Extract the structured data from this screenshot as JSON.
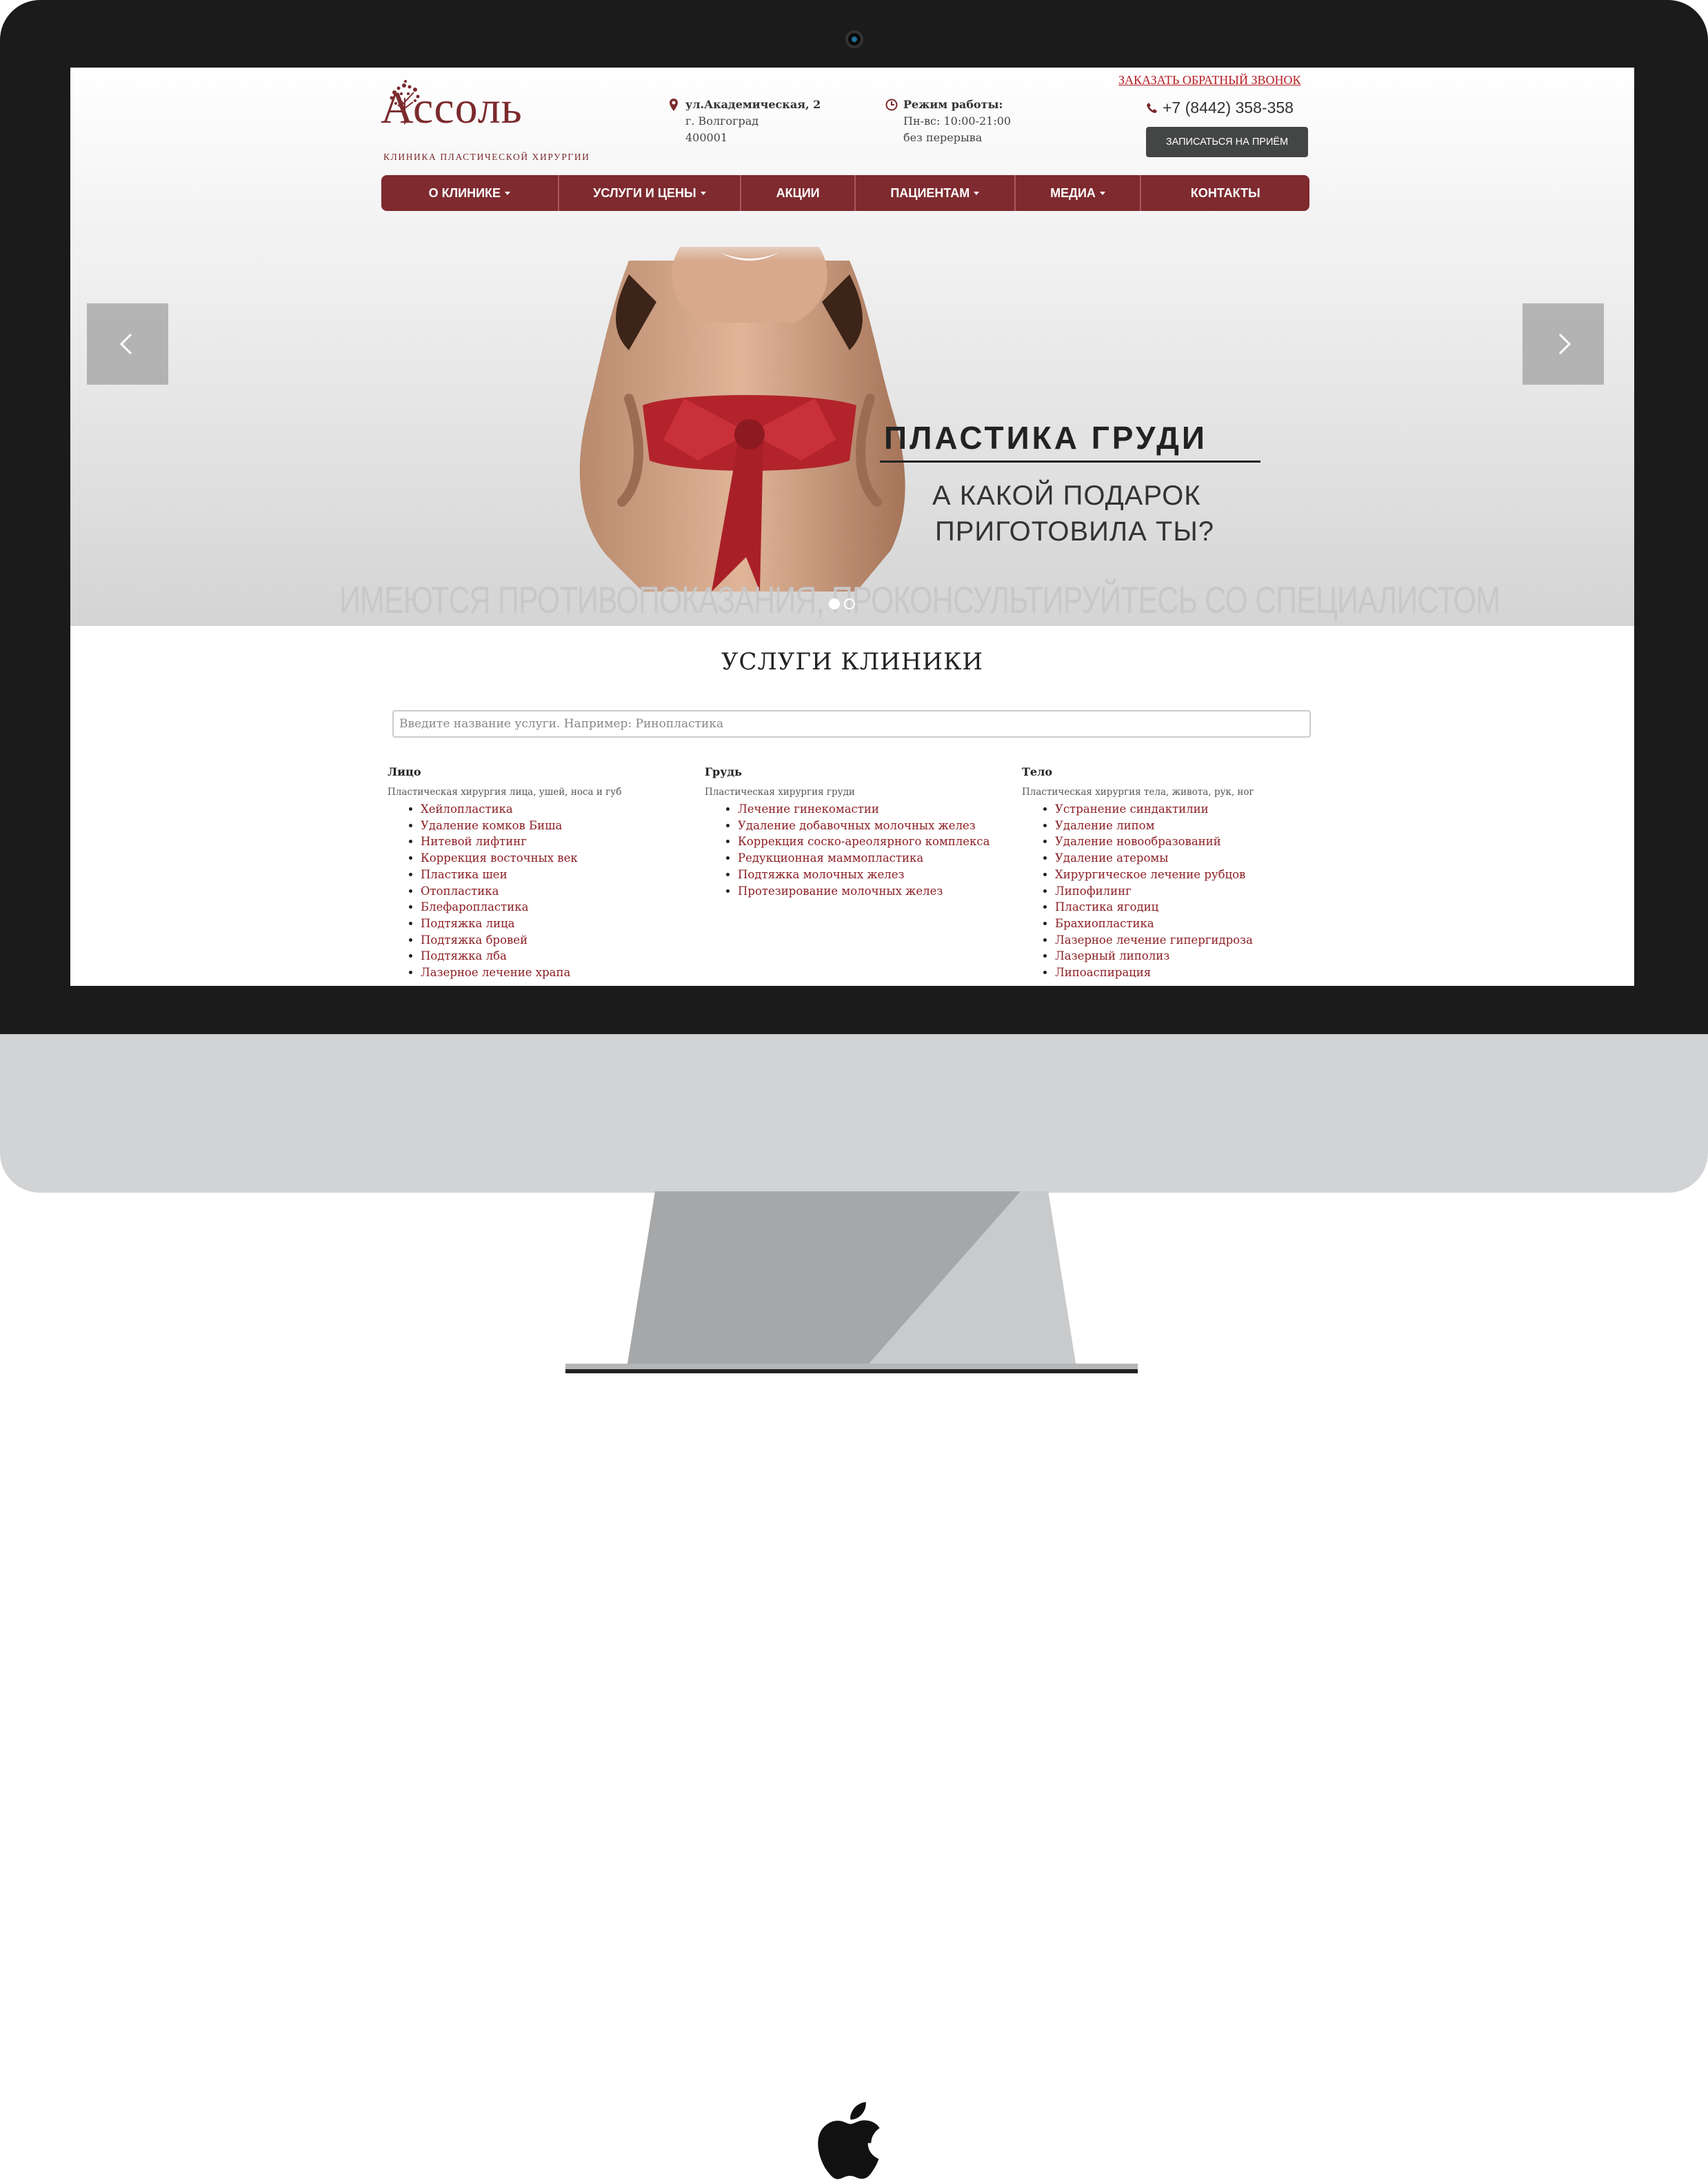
{
  "site": {
    "logo_text": "Ассоль",
    "logo_subtitle": "клиника пластической хирургии",
    "address": {
      "line1": "ул.Академическая, 2",
      "line2": "г. Волгоград",
      "line3": "400001"
    },
    "hours": {
      "title": "Режим работы:",
      "line1": "Пн-вс: 10:00-21:00",
      "line2": "без перерыва"
    },
    "callback_link": "ЗАКАЗАТЬ ОБРАТНЫЙ ЗВОНОК",
    "phone": "+7 (8442) 358-358",
    "appointment_button": "ЗАПИСАТЬСЯ НА ПРИЁМ"
  },
  "nav": [
    {
      "label": "О КЛИНИКЕ",
      "dropdown": true
    },
    {
      "label": "УСЛУГИ И ЦЕНЫ",
      "dropdown": true
    },
    {
      "label": "АКЦИИ",
      "dropdown": false
    },
    {
      "label": "ПАЦИЕНТАМ",
      "dropdown": true
    },
    {
      "label": "МЕДИА",
      "dropdown": true
    },
    {
      "label": "КОНТАКТЫ",
      "dropdown": false
    }
  ],
  "slider": {
    "title": "ПЛАСТИКА ГРУДИ",
    "subtitle_line1": "А КАКОЙ ПОДАРОК",
    "subtitle_line2": "ПРИГОТОВИЛА ТЫ?",
    "disclaimer": "ИМЕЮТСЯ ПРОТИВОПОКАЗАНИЯ, ПРОКОНСУЛЬТИРУЙТЕСЬ СО СПЕЦИАЛИСТОМ",
    "slide_count": 2,
    "active_slide": 1
  },
  "services": {
    "title": "УСЛУГИ КЛИНИКИ",
    "search_placeholder": "Введите название услуги. Например: Ринопластика",
    "columns": [
      {
        "heading": "Лицо",
        "description": "Пластическая хирургия лица, ушей, носа и губ",
        "items": [
          "Хейлопластика",
          "Удаление комков Биша",
          "Нитевой лифтинг",
          "Коррекция восточных век",
          "Пластика шеи",
          "Отопластика",
          "Блефаропластика",
          "Подтяжка лица",
          "Подтяжка бровей",
          "Подтяжка лба",
          "Лазерное лечение храпа"
        ]
      },
      {
        "heading": "Грудь",
        "description": "Пластическая хирургия груди",
        "items": [
          "Лечение гинекомастии",
          "Удаление добавочных молочных желез",
          "Коррекция соско-ареолярного комплекса",
          "Редукционная маммопластика",
          "Подтяжка молочных желез",
          "Протезирование молочных желез"
        ]
      },
      {
        "heading": "Тело",
        "description": "Пластическая хирургия тела, живота, рук, ног",
        "items": [
          "Устранение синдактилии",
          "Удаление липом",
          "Удаление новообразований",
          "Удаление атеромы",
          "Хирургическое лечение рубцов",
          "Липофилинг",
          "Пластика ягодиц",
          "Брахиопластика",
          "Лазерное лечение гипергидроза",
          "Лазерный липолиз",
          "Липоаспирация"
        ]
      }
    ]
  },
  "colors": {
    "brand": "#7e2a2f",
    "link": "#8b1f24",
    "callback": "#b51d24",
    "bezel": "#1b1b1b",
    "chin": "#d2d3d5"
  },
  "icons": [
    "map-pin-icon",
    "clock-icon",
    "phone-icon",
    "chevron-left-icon",
    "chevron-right-icon",
    "apple-logo-icon"
  ]
}
